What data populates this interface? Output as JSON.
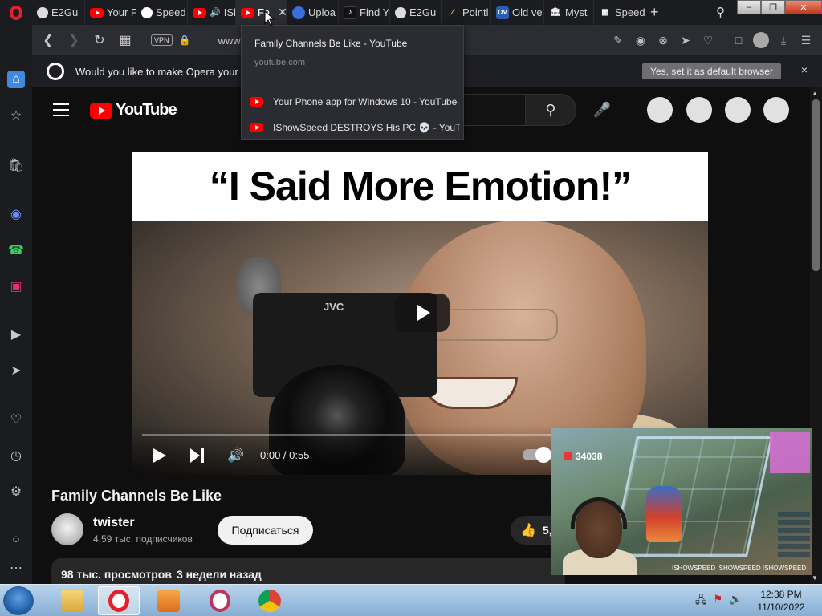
{
  "tabs": [
    {
      "label": "E2Gu",
      "icon": "e2-icon"
    },
    {
      "label": "Your P",
      "icon": "youtube-icon"
    },
    {
      "label": "Speed",
      "icon": "github-icon"
    },
    {
      "label": "ISh",
      "icon": "youtube-icon"
    },
    {
      "label": "Fa",
      "icon": "youtube-icon",
      "active": true
    },
    {
      "label": "Uploa",
      "icon": "upload-icon"
    },
    {
      "label": "Find Y",
      "icon": "tiktok-icon"
    },
    {
      "label": "E2Gu",
      "icon": "e2-icon"
    },
    {
      "label": "Pointl",
      "icon": "pointer-icon"
    },
    {
      "label": "Old ve",
      "icon": "ov-icon"
    },
    {
      "label": "Myst",
      "icon": "museum-icon"
    },
    {
      "label": "Speed",
      "icon": "grid-icon"
    }
  ],
  "tab_new": "+",
  "address": {
    "vpn": "VPN",
    "url": "www.y"
  },
  "infobar": {
    "message": "Would you like to make Opera your ev",
    "button": "Yes, set it as default browser",
    "close": "×"
  },
  "tooltip": {
    "title": "Family Channels Be Like - YouTube",
    "url": "youtube.com",
    "items": [
      {
        "label": "Your Phone app for Windows 10 - YouTube"
      },
      {
        "label": "IShowSpeed DESTROYS His PC 💀 - YouT..."
      }
    ]
  },
  "youtube": {
    "logo_text": "YouTube",
    "video": {
      "banner_text": "“I Said More Emotion!”",
      "camera_brand": "JVC",
      "time": "0:00 / 0:55",
      "progress": 0.0
    },
    "title": "Family Channels Be Like",
    "channel": "twister",
    "subscribers": "4,59 тыс. подписчиков",
    "subscribe_label": "Подписаться",
    "likes": "5,",
    "views": "98 тыс. просмотров",
    "uploaded": "3 недели назад"
  },
  "mini_player": {
    "score": "34038",
    "credit": "ISHOWSPEED  ISHOWSPEED  ISHOWSPEED"
  },
  "taskbar": {
    "clock_time": "12:38 PM",
    "clock_date": "11/10/2022"
  },
  "colors": {
    "accent": "#ff0000",
    "opera": "#e4202c"
  }
}
